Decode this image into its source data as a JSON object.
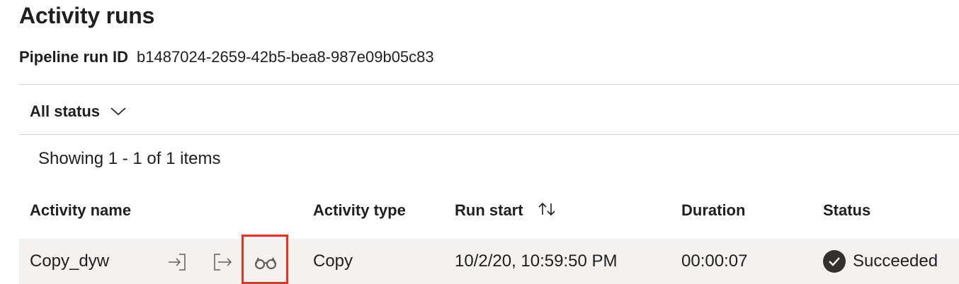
{
  "page": {
    "title": "Activity runs"
  },
  "run": {
    "id_label": "Pipeline run ID",
    "id_value": "b1487024-2659-42b5-bea8-987e09b05c83"
  },
  "filter": {
    "label": "All status"
  },
  "pagination": {
    "text": "Showing 1 - 1 of 1 items"
  },
  "table": {
    "headers": {
      "activity_name": "Activity name",
      "activity_type": "Activity type",
      "run_start": "Run start",
      "duration": "Duration",
      "status": "Status"
    },
    "rows": [
      {
        "activity_name": "Copy_dyw",
        "actions": [
          "input-icon",
          "output-icon",
          "details-glasses-icon"
        ],
        "activity_type": "Copy",
        "run_start": "10/2/20, 10:59:50 PM",
        "duration": "00:00:07",
        "status": "Succeeded"
      }
    ]
  },
  "colors": {
    "highlight": "#e8331f",
    "row_bg": "#f3f2f1",
    "icon": "#605e5c",
    "status_icon": "#323130"
  }
}
